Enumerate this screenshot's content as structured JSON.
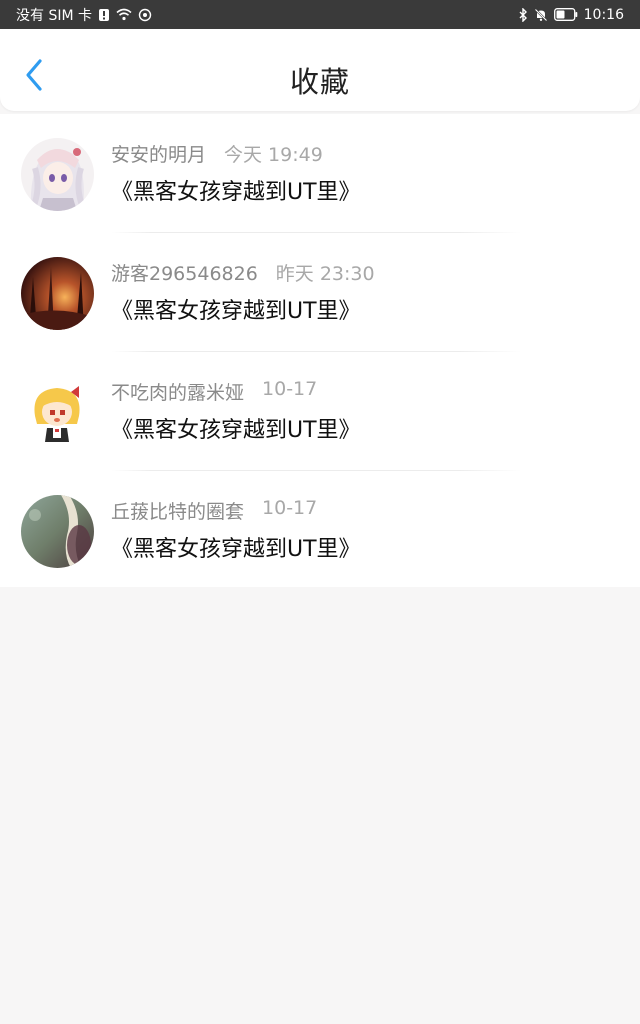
{
  "status_bar": {
    "carrier": "没有 SIM 卡",
    "time": "10:16"
  },
  "header": {
    "title": "收藏",
    "back_icon": "chevron-left-icon",
    "accent_color": "#2f9cf0"
  },
  "favorites": [
    {
      "user": "安安的明月",
      "time": "今天 19:49",
      "book": "《黑客女孩穿越到UT里》",
      "avatar": "anime-girl-avatar"
    },
    {
      "user": "游客296546826",
      "time": "昨天 23:30",
      "book": "《黑客女孩穿越到UT里》",
      "avatar": "forest-sunset-avatar"
    },
    {
      "user": "不吃肉的露米娅",
      "time": "10-17",
      "book": "《黑客女孩穿越到UT里》",
      "avatar": "chibi-rumia-avatar"
    },
    {
      "user": "丘菝比特的圈套",
      "time": "10-17",
      "book": "《黑客女孩穿越到UT里》",
      "avatar": "blurry-nature-avatar"
    }
  ]
}
